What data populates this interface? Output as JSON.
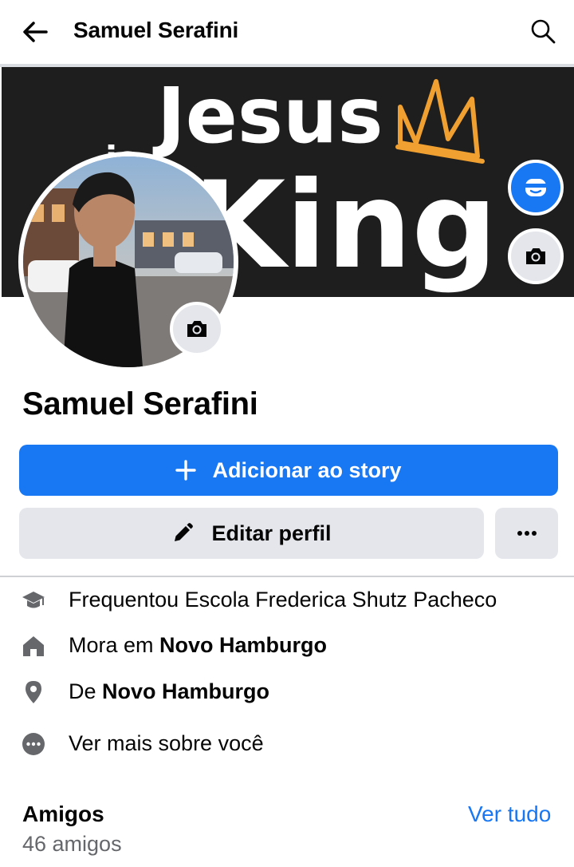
{
  "header": {
    "title": "Samuel Serafini"
  },
  "cover": {
    "text_line1": "Jesus",
    "text_line2": "is",
    "text_line3": "King"
  },
  "profile": {
    "name": "Samuel Serafini"
  },
  "actions": {
    "add_story": "Adicionar ao story",
    "edit_profile": "Editar perfil"
  },
  "details": {
    "education": "Frequentou Escola Frederica Shutz Pacheco",
    "lives_prefix": "Mora em ",
    "lives_city": "Novo Hamburgo",
    "from_prefix": "De ",
    "from_city": "Novo Hamburgo",
    "see_more": "Ver mais sobre você"
  },
  "friends": {
    "title": "Amigos",
    "count": "46 amigos",
    "see_all": "Ver tudo"
  },
  "colors": {
    "accent": "#1877f2",
    "button_gray": "#e4e6eb",
    "secondary_text": "#65676b",
    "crown": "#f0a030"
  },
  "icons": [
    "back-arrow-icon",
    "search-icon",
    "avatar-icon",
    "camera-icon",
    "plus-icon",
    "pencil-icon",
    "more-icon",
    "graduation-cap-icon",
    "home-icon",
    "location-pin-icon",
    "more-circle-icon"
  ]
}
